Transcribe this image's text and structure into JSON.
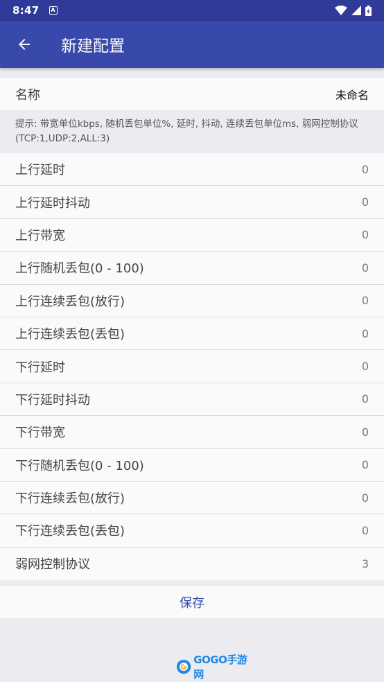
{
  "status_bar": {
    "time": "8:47",
    "notification_icon": "A"
  },
  "app_bar": {
    "title": "新建配置"
  },
  "name": {
    "label": "名称",
    "value": "未命名"
  },
  "hint": "提示: 带宽单位kbps, 随机丢包单位%, 延时, 抖动, 连续丢包单位ms, 弱网控制协议(TCP:1,UDP:2,ALL:3)",
  "settings": [
    {
      "label": "上行延时",
      "value": "0"
    },
    {
      "label": "上行延时抖动",
      "value": "0"
    },
    {
      "label": "上行带宽",
      "value": "0"
    },
    {
      "label": "上行随机丢包(0 - 100)",
      "value": "0"
    },
    {
      "label": "上行连续丢包(放行)",
      "value": "0"
    },
    {
      "label": "上行连续丢包(丢包)",
      "value": "0"
    },
    {
      "label": "下行延时",
      "value": "0"
    },
    {
      "label": "下行延时抖动",
      "value": "0"
    },
    {
      "label": "下行带宽",
      "value": "0"
    },
    {
      "label": "下行随机丢包(0 - 100)",
      "value": "0"
    },
    {
      "label": "下行连续丢包(放行)",
      "value": "0"
    },
    {
      "label": "下行连续丢包(丢包)",
      "value": "0"
    },
    {
      "label": "弱网控制协议",
      "value": "3"
    }
  ],
  "save_label": "保存",
  "watermark": {
    "text": "GOGO手游网"
  },
  "colors": {
    "primary": "#3949ab",
    "primary_dark": "#2f3a99",
    "background": "#ececf0"
  }
}
